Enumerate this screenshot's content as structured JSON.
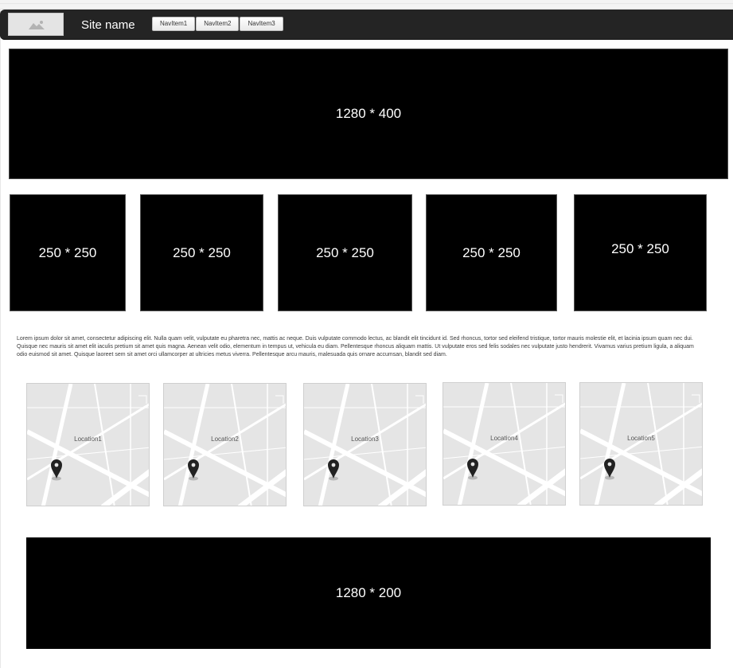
{
  "navbar": {
    "logo_icon": "image-placeholder-icon",
    "site_name": "Site name",
    "nav_items": [
      "NavItem1",
      "NavItem2",
      "NavItem3"
    ]
  },
  "hero": {
    "label": "1280 * 400"
  },
  "tiles": [
    "250 * 250",
    "250 * 250",
    "250 * 250",
    "250 * 250",
    "250 * 250"
  ],
  "body_text": "Lorem ipsum dolor sit amet, consectetur adipiscing elit. Nulla quam velit, vulputate eu pharetra nec, mattis ac neque. Duis vulputate commodo lectus, ac blandit elit tincidunt id. Sed rhoncus, tortor sed eleifend tristique, tortor mauris molestie elit, et lacinia ipsum quam nec dui. Quisque nec mauris sit amet elit iaculis pretium sit amet quis magna. Aenean velit odio, elementum in tempus ut, vehicula eu diam. Pellentesque rhoncus aliquam mattis. Ut vulputate eros sed felis sodales nec vulputate justo hendrerit. Vivamus varius pretium ligula, a aliquam odio euismod sit amet. Quisque laoreet sem sit amet orci ullamcorper at ultricies metus viverra. Pellentesque arcu mauris, malesuada quis ornare accumsan, blandit sed diam.",
  "maps": [
    {
      "label": "Location1",
      "icon": "map-pin-icon"
    },
    {
      "label": "Location2",
      "icon": "map-pin-icon"
    },
    {
      "label": "Location3",
      "icon": "map-pin-icon"
    },
    {
      "label": "Location4",
      "icon": "map-pin-icon"
    },
    {
      "label": "Location5",
      "icon": "map-pin-icon"
    }
  ],
  "footer": {
    "label": "1280 * 200"
  },
  "colors": {
    "navbar_bg": "#242424",
    "placeholder_bg": "#000000",
    "map_bg": "#e5e5e5",
    "map_roads": "#ffffff"
  }
}
